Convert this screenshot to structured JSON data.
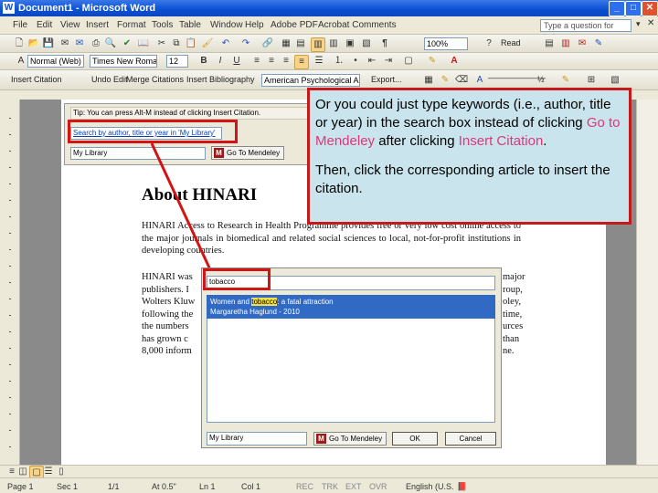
{
  "window": {
    "title": "Document1 - Microsoft Word",
    "app_icon": "W"
  },
  "menu": {
    "items": [
      "File",
      "Edit",
      "View",
      "Insert",
      "Format",
      "Tools",
      "Table",
      "Window",
      "Help",
      "Adobe PDF",
      "Acrobat Comments"
    ],
    "help_placeholder": "Type a question for help"
  },
  "toolbar": {
    "zoom": "100%",
    "read_label": "Read",
    "style": "Normal (Web)",
    "font": "Times New Roman",
    "size": "12",
    "bold": "B",
    "italic": "I",
    "underline": "U",
    "mendeley": {
      "insert_citation": "Insert Citation",
      "undo_edit": "Undo Edit",
      "merge_citations": "Merge Citations",
      "insert_bibliography": "Insert Bibliography",
      "style": "American Psychological Asso",
      "export": "Export..."
    },
    "size2": "½"
  },
  "mendeley_dialog": {
    "tip": "Tip: You can press Alt-M instead of clicking Insert Citation.",
    "search_value": "Search by author, title or year in 'My Library'",
    "library": "My Library",
    "goto_label": "Go To Mendeley"
  },
  "document": {
    "heading": "About HINARI",
    "para1": "HINARI Access to Research in Health Programme provides free or very low cost online access to the major journals in biomedical and related social sciences to local, not-for-profit institutions in developing countries.",
    "para2_left": [
      "HINARI was",
      "publishers. I",
      "Wolters Kluw",
      "following the",
      "the numbers",
      "has grown c",
      "8,000 inform"
    ],
    "para2_right": [
      "major",
      "roup,",
      "oley,",
      "time,",
      "urces",
      "than",
      "ne."
    ]
  },
  "popup": {
    "search_value": "tobacco",
    "result_title_pre": "Women and ",
    "result_title_hl": "tobacco",
    "result_title_post": ": a fatal attraction",
    "result_author": "Margaretha Haglund - 2010",
    "library": "My Library",
    "goto_label": "Go To Mendeley",
    "ok_label": "OK",
    "cancel_label": "Cancel"
  },
  "callout": {
    "p1_pre": "Or you could just type keywords (i.e., author, title or year) in the search box instead of clicking ",
    "p1_link1": "Go to Mendeley",
    "p1_mid": " after clicking ",
    "p1_link2": "Insert Citation",
    "p1_post": ".",
    "p2": "Then, click the corresponding article to insert the citation.",
    "colors": {
      "border": "#c41a1a",
      "background": "#c9e4ec",
      "emphasis": "#e2357a"
    }
  },
  "status": {
    "page": "Page 1",
    "sec": "Sec 1",
    "pages": "1/1",
    "at": "At 0.5\"",
    "ln": "Ln 1",
    "col": "Col 1",
    "rec": "REC",
    "trk": "TRK",
    "ext": "EXT",
    "ovr": "OVR",
    "lang": "English (U.S."
  }
}
